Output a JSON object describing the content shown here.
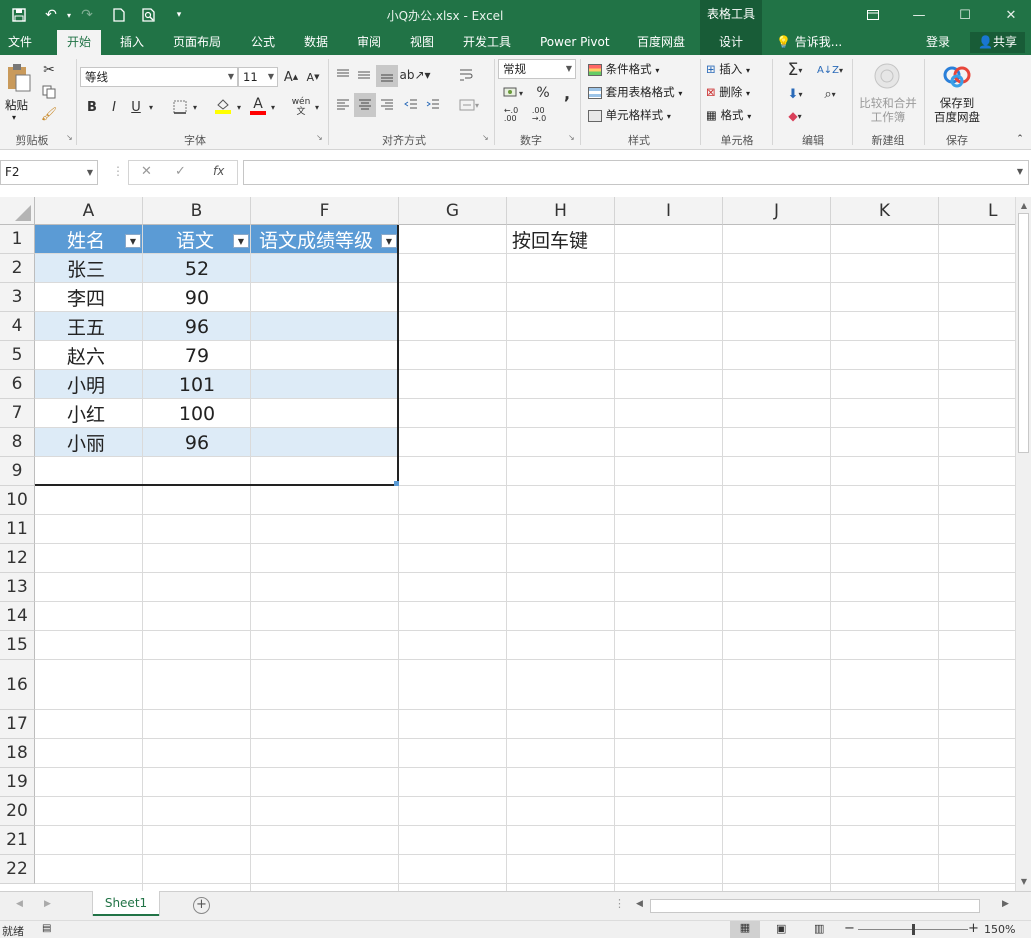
{
  "window": {
    "title": "小Q办公.xlsx - Excel",
    "contextual_tools_label": "表格工具"
  },
  "tabs": [
    "文件",
    "开始",
    "插入",
    "页面布局",
    "公式",
    "数据",
    "审阅",
    "视图",
    "开发工具",
    "Power Pivot",
    "百度网盘",
    "设计"
  ],
  "active_tab": "开始",
  "tell_me": "告诉我...",
  "account": {
    "login": "登录",
    "share": "共享"
  },
  "ribbon": {
    "clipboard": {
      "paste": "粘贴",
      "label": "剪贴板"
    },
    "font": {
      "name": "等线",
      "size": "11",
      "label": "字体",
      "bold": "B",
      "italic": "I",
      "underline": "U",
      "phonetic": "wén 文"
    },
    "alignment": {
      "label": "对齐方式"
    },
    "number": {
      "format": "常规",
      "percent": "%",
      "comma": ",",
      "label": "数字"
    },
    "styles": {
      "conditional": "条件格式",
      "table_format": "套用表格格式",
      "cell_styles": "单元格样式",
      "label": "样式"
    },
    "cells": {
      "insert": "插入",
      "delete": "删除",
      "format": "格式",
      "label": "单元格"
    },
    "editing": {
      "label": "编辑"
    },
    "compare": {
      "line1": "比较和合并",
      "line2": "工作簿",
      "label": "新建组"
    },
    "save": {
      "line1": "保存到",
      "line2": "百度网盘",
      "label": "保存"
    }
  },
  "formula_bar": {
    "name_box": "F2",
    "fx": "fx",
    "cancel": "✕",
    "confirm": "✓",
    "value": ""
  },
  "columns": [
    "A",
    "B",
    "F",
    "G",
    "H",
    "I",
    "J",
    "K",
    "L"
  ],
  "rows": [
    "1",
    "2",
    "3",
    "4",
    "5",
    "6",
    "7",
    "8",
    "9",
    "10",
    "11",
    "12",
    "13",
    "14",
    "15",
    "16",
    "17",
    "18",
    "19",
    "20",
    "21",
    "22"
  ],
  "table": {
    "headers": [
      "姓名",
      "语文",
      "语文成绩等级"
    ],
    "rows": [
      {
        "name": "张三",
        "score": "52"
      },
      {
        "name": "李四",
        "score": "90"
      },
      {
        "name": "王五",
        "score": "96"
      },
      {
        "name": "赵六",
        "score": "79"
      },
      {
        "name": "小明",
        "score": "101"
      },
      {
        "name": "小红",
        "score": "100"
      },
      {
        "name": "小丽",
        "score": "96"
      }
    ]
  },
  "annotation": "按回车键",
  "sheets": [
    "Sheet1"
  ],
  "status": {
    "ready": "就绪",
    "zoom": "150%"
  },
  "colors": {
    "excel_green": "#217346",
    "table_header": "#5b9bd5",
    "table_band": "#ddebf7"
  }
}
